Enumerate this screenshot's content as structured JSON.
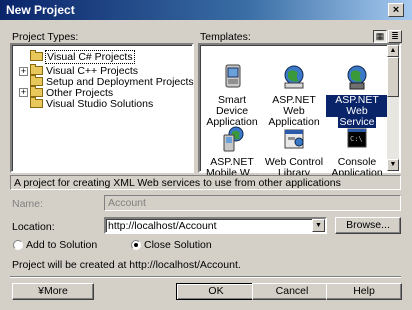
{
  "window": {
    "title": "New Project",
    "close_glyph": "×"
  },
  "project_types": {
    "label": "Project Types:",
    "items": [
      {
        "label": "Visual C# Projects",
        "expander": "",
        "selected": true
      },
      {
        "label": "Visual C++ Projects",
        "expander": "+"
      },
      {
        "label": "Setup and Deployment Projects",
        "expander": ""
      },
      {
        "label": "Other Projects",
        "expander": "+"
      },
      {
        "label": "Visual Studio Solutions",
        "expander": ""
      }
    ]
  },
  "templates": {
    "label": "Templates:",
    "items": [
      {
        "line1": "Smart Device",
        "line2": "Application",
        "icon": "smart-device-icon"
      },
      {
        "line1": "ASP.NET Web",
        "line2": "Application",
        "icon": "asp-net-web-app-icon"
      },
      {
        "line1": "ASP.NET Web",
        "line2": "Service",
        "icon": "asp-net-web-service-icon",
        "selected": true
      },
      {
        "line1": "ASP.NET",
        "line2": "Mobile W...",
        "icon": "asp-net-mobile-icon"
      },
      {
        "line1": "Web Control",
        "line2": "Library",
        "icon": "web-control-library-icon"
      },
      {
        "line1": "Console",
        "line2": "Application",
        "icon": "console-app-icon"
      }
    ]
  },
  "description": "A project for creating XML Web services to use from other applications",
  "form": {
    "name_label": "Name:",
    "name_value": "Account",
    "location_label": "Location:",
    "location_value": "http://localhost/Account",
    "browse_label": "Browse...",
    "add_to_solution_label": "Add to Solution",
    "close_solution_label": "Close Solution",
    "created_at_text": "Project will be created at http://localhost/Account."
  },
  "buttons": {
    "more": "¥More",
    "ok": "OK",
    "cancel": "Cancel",
    "help": "Help"
  },
  "colors": {
    "title_start": "#0a246a",
    "title_end": "#a6caf0",
    "selection": "#0a246a",
    "face": "#d4d0c8"
  }
}
